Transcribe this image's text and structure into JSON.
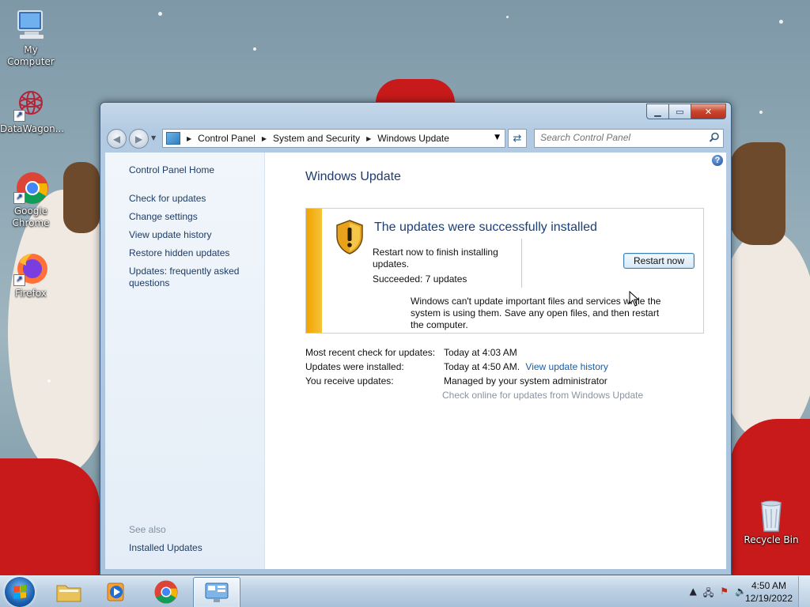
{
  "desktop": {
    "icons": [
      {
        "label": "My Computer",
        "icon": "computer-icon"
      },
      {
        "label": "DataWagon...",
        "icon": "datawagon-icon"
      },
      {
        "label": "Google Chrome",
        "icon": "chrome-icon"
      },
      {
        "label": "Firefox",
        "icon": "firefox-icon"
      },
      {
        "label": "Recycle Bin",
        "icon": "recycle-bin-icon"
      }
    ]
  },
  "window": {
    "breadcrumbs": [
      "Control Panel",
      "System and Security",
      "Windows Update"
    ],
    "search_placeholder": "Search Control Panel"
  },
  "sidebar": {
    "home": "Control Panel Home",
    "links": [
      "Check for updates",
      "Change settings",
      "View update history",
      "Restore hidden updates",
      "Updates: frequently asked questions"
    ],
    "see_also": "See also",
    "see_also_links": [
      "Installed Updates"
    ]
  },
  "main": {
    "title": "Windows Update",
    "status": {
      "heading": "The updates were successfully installed",
      "restart_text": "Restart now to finish installing updates.",
      "succeeded": "Succeeded: 7 updates",
      "restart_button": "Restart now",
      "warning": "Windows can't update important files and services while the system is using them. Save any open files, and then restart the computer."
    },
    "info": [
      {
        "label": "Most recent check for updates:",
        "value": "Today at 4:03 AM"
      },
      {
        "label": "Updates were installed:",
        "value": "Today at 4:50 AM.",
        "link": "View update history"
      },
      {
        "label": "You receive updates:",
        "value": "Managed by your system administrator"
      }
    ],
    "online_link": "Check online for updates from Windows Update"
  },
  "taskbar": {
    "time": "4:50 AM",
    "date": "12/19/2022"
  }
}
